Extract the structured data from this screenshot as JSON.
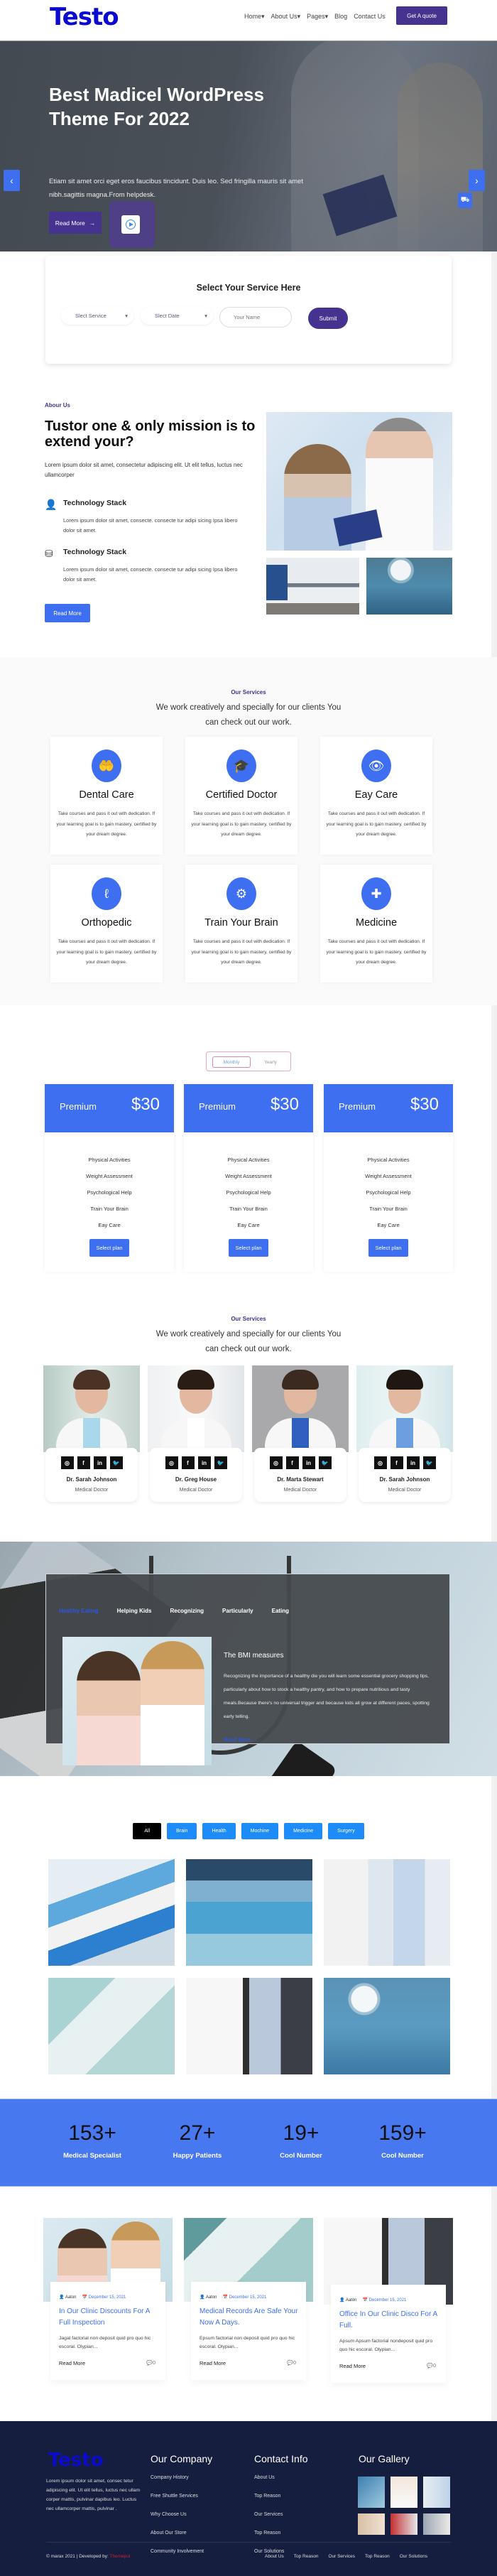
{
  "header": {
    "logo": "Testo",
    "nav": [
      "Home",
      "About Us",
      "Pages",
      "Blog",
      "Contact Us"
    ],
    "nav_dropdown_marker": "▾",
    "cta": "Get A quote"
  },
  "hero": {
    "title": "Best Madicel WordPress Theme For 2022",
    "text": "Etiam sit amet orci eget eros faucibus tincidunt. Duis leo. Sed fringilla mauris sit amet nibh.sagittis magna.From helpdesk.",
    "read_more": "Read More",
    "read_more_arrow": "→",
    "prev_icon": "‹",
    "next_icon": "›",
    "side_icon": "⛟"
  },
  "booking": {
    "title": "Select Your Service Here",
    "service_select": "Slect Service",
    "date_select": "Slect Date",
    "name_placeholder": "Your Name",
    "submit": "Submit",
    "chevron": "▾"
  },
  "about": {
    "eyebrow": "Abour Us",
    "title": "Tustor one & only mission is to extend your?",
    "text": "Lorem ipsum dolor sit amet, consectetur adipiscing elit. Ut elit tellus, luctus nec ullamcorper",
    "features": [
      {
        "title": "Technology Stack",
        "text": "Lorem ipsum dolor sit amet, consecte. consecte tur adipi sicing Ipsa libero dolor sit amet.",
        "icon": "👤"
      },
      {
        "title": "Technology Stack",
        "text": "Lorem ipsum dolor sit amet, consecte. consecte tur adipi sicing Ipsa libero dolor sit amet.",
        "icon": "⛁"
      }
    ],
    "button": "Read More"
  },
  "services": {
    "eyebrow": "Our Services",
    "heading_line1": "We work creatively and specially for our clients You",
    "heading_line2": "can check out our work.",
    "items": [
      {
        "title": "Dental Care",
        "icon": "🤲",
        "text": "Take courses and pass it out with dedication. If your learning goal is to gain mastery, certified by your dream degree."
      },
      {
        "title": "Certified Doctor",
        "icon": "🎓",
        "text": "Take courses and pass it out with dedication. If your learning goal is to gain mastery, certified by your dream degree."
      },
      {
        "title": "Eay Care",
        "icon": "👁",
        "text": "Take courses and pass it out with dedication. If your learning goal is to gain mastery, certified by your dream degree."
      },
      {
        "title": "Orthopedic",
        "icon": "ℓ",
        "text": "Take courses and pass it out with dedication. If your learning goal is to gain mastery, certified by your dream degree."
      },
      {
        "title": "Train Your Brain",
        "icon": "⚙",
        "text": "Take courses and pass it out with dedication. If your learning goal is to gain mastery, certified by your dream degree."
      },
      {
        "title": "Medicine",
        "icon": "✚",
        "text": "Take courses and pass it out with dedication. If your learning goal is to gain mastery, certified by your dream degree."
      }
    ]
  },
  "pricing": {
    "toggle": {
      "monthly": "Monthly",
      "yearly": "Yearly",
      "selected": "Monthly"
    },
    "plans": [
      {
        "name": "Premium",
        "price": "$30",
        "features": [
          "Physical Activities",
          "Weight Assessment",
          "Psychological Help",
          "Train Your Brain",
          "Eay Care"
        ],
        "button": "Select plan"
      },
      {
        "name": "Premium",
        "price": "$30",
        "features": [
          "Physical Activities",
          "Weight Assessment",
          "Psychological Help",
          "Train Your Brain",
          "Eay Care"
        ],
        "button": "Select plan"
      },
      {
        "name": "Premium",
        "price": "$30",
        "features": [
          "Physical Activities",
          "Weight Assessment",
          "Psychological Help",
          "Train Your Brain",
          "Eay Care"
        ],
        "button": "Select plan"
      }
    ]
  },
  "team": {
    "eyebrow": "Our Services",
    "heading_line1": "We work creatively and specially for our clients You",
    "heading_line2": "can check out our work.",
    "socials": [
      "◎",
      "f",
      "in",
      "🐦"
    ],
    "members": [
      {
        "name": "Dr. Sarah Johnson",
        "role": "Medical Doctor"
      },
      {
        "name": "Dr. Greg House",
        "role": "Medical Doctor"
      },
      {
        "name": "Dr. Marta Stewart",
        "role": "Medical Doctor"
      },
      {
        "name": "Dr. Sarah Johnson",
        "role": "Medical Doctor"
      }
    ]
  },
  "health_tabs": {
    "tabs": [
      "Healthy Eating",
      "Helping Kids",
      "Recognizing",
      "Particularly",
      "Eating"
    ],
    "active_tab": "Healthy Eating",
    "title": "The BMI measures",
    "text": "Recognizing the importance of a healthy die you will learn some essential grocery shopping tips, particularly about how to stock a healthy pantry, and how to prepare nutritious and tasty meals.Because there's no universal trigger and because kids all grow at different paces, spotting early telling.",
    "read_more": "Read More →"
  },
  "gallery": {
    "filters": [
      "All",
      "Brain",
      "Health",
      "Machine",
      "Medicine",
      "Surgery"
    ],
    "active_filter": "All",
    "filters_display": [
      "All",
      "Brain",
      "Health",
      "Mochine",
      "Medicine",
      "Surgery"
    ]
  },
  "counters": [
    {
      "number": "153+",
      "label": "Medical Specialist"
    },
    {
      "number": "27+",
      "label": "Happy Patients"
    },
    {
      "number": "19+",
      "label": "Cool Number"
    },
    {
      "number": "159+",
      "label": "Cool Number"
    }
  ],
  "blog": {
    "posts": [
      {
        "author": "Aaton",
        "date": "December 15, 2021",
        "title": "In Our Clinic Discounts For A Full Inspection",
        "excerpt": "Jagal factorial non deposit quid pro quo hic escoral. Olypian...",
        "read_more": "Read More",
        "comments": "0"
      },
      {
        "author": "Aaton",
        "date": "December 15, 2021",
        "title": "Medical Records Are Safe Your Now A Days.",
        "excerpt": "Epsum factorial non deposit quid pro quo hic escoral. Olypian...",
        "read_more": "Read More",
        "comments": "0"
      },
      {
        "author": "Aaton",
        "date": "December 15, 2021",
        "title": "Office In Our Clinic Disco For A Full.",
        "excerpt": "Apsum Apsum factorial nondeposit quid pro quo hic escoral. Olypian...",
        "read_more": "Read More",
        "comments": "0"
      }
    ]
  },
  "footer": {
    "logo": "Testo",
    "about": "Lorem ipsum dolor sit amet, consec tetur adipiscing elit. Ut elit tellus, luctus nec ullam corper mattis, pulvinar dapibus leo. Luctus nec ullamcorper mattis, pulvinar .",
    "company": {
      "title": "Our Company",
      "links": [
        "Company History",
        "Free Shuttle Services",
        "Why Choose Us",
        "About Our Store",
        "Community Involvement"
      ]
    },
    "contact": {
      "title": "Contact Info",
      "links": [
        "About Us",
        "Top Reason",
        "Our Services",
        "Top Reason",
        "Our Solutions"
      ]
    },
    "gallery_title": "Our Gallery",
    "copyright": "© marax 2021 | Developed by: ",
    "developer": "Themepul",
    "bottom_links": [
      "About Us",
      "Top Reason",
      "Our Services",
      "Top Reason",
      "Our Solutions"
    ]
  },
  "colors": {
    "primary_purple": "#45338f",
    "accent_blue": "#3d6ff0",
    "logo_blue": "#0b0bd0",
    "filter_blue": "#1e8cf8",
    "footer_bg": "#161e3f",
    "counter_bg": "#4878f0"
  }
}
